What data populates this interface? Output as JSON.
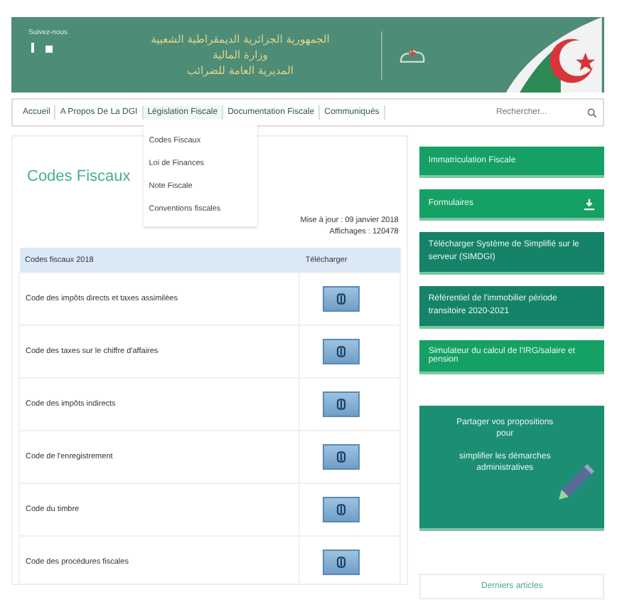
{
  "header": {
    "follow_label": "Suivez-nous",
    "social": [
      {
        "kind": "facebook"
      },
      {
        "kind": "twitter"
      }
    ],
    "title_lines": [
      "الجمهورية الجزائرية الديمقراطية الشعبية",
      "وزارة المالية",
      "المديرية العامة للضرائب"
    ]
  },
  "nav": {
    "items": [
      {
        "label": "Accueil",
        "expanded": false
      },
      {
        "label": "A Propos De La DGI",
        "expanded": false
      },
      {
        "label": "Législation Fiscale",
        "expanded": true
      },
      {
        "label": "Documentation Fiscale",
        "expanded": false
      },
      {
        "label": "Communiqués",
        "expanded": false
      }
    ],
    "search": {
      "placeholder": "Rechercher..."
    }
  },
  "dropdown": [
    "Codes Fiscaux",
    "Loi de Finances",
    "Note Fiscale",
    "Conventions fiscales"
  ],
  "page": {
    "title": "Codes Fiscaux",
    "updated": "Mise à jour : 09 janvier 2018",
    "views": "Affichages : 120478"
  },
  "table": {
    "columns": [
      "Codes fiscaux 2018",
      "Télécharger"
    ],
    "rows": [
      {
        "name": "Code des impôts directs et taxes assimilées"
      },
      {
        "name": "Code des taxes sur le chiffre d'affaires"
      },
      {
        "name": "Code des impôts indirects"
      },
      {
        "name": "Code de l'enregistrement"
      },
      {
        "name": "Code du timbre"
      },
      {
        "name": "Code des procédures fiscales"
      }
    ]
  },
  "sidebar": {
    "links": [
      {
        "label": "Immatriculation Fiscale",
        "kind": "plain"
      },
      {
        "label": "Formulaires",
        "kind": "download"
      },
      {
        "label": "Télécharger Système de Simplifié sur le serveur (SIMDGI)",
        "kind": "dark"
      },
      {
        "label": "Référentiel de l'immobilier période transitoire 2020-2021",
        "kind": "dark"
      },
      {
        "label": "Simulateur du calcul de l'IRG/salaire et pension",
        "kind": "plain"
      }
    ],
    "proposal": {
      "lines": [
        "Partager vos propositions pour",
        "simplifier les démarches administratives"
      ]
    },
    "recent_title": "Derniers articles"
  }
}
